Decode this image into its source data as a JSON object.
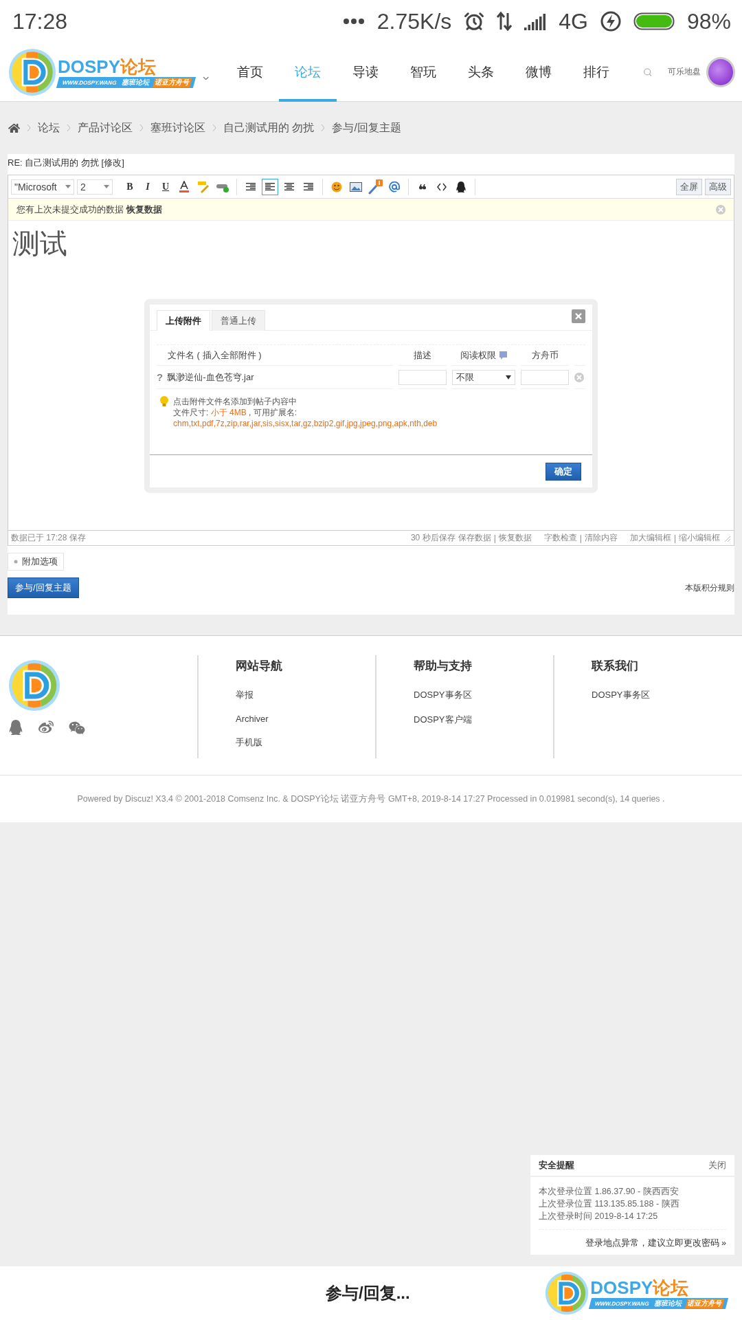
{
  "status_bar": {
    "time": "17:28",
    "speed": "2.75K/s",
    "network": "4G",
    "battery": "98%"
  },
  "header": {
    "logo": {
      "name": "DOSPY",
      "name_cn": "论坛",
      "url": "WWW.DOSPY.WANG",
      "tag_1": "塞班论坛",
      "tag_2": "诺亚方舟号"
    },
    "nav": [
      {
        "label": "首页",
        "selected": false
      },
      {
        "label": "论坛",
        "selected": true
      },
      {
        "label": "导读",
        "selected": false
      },
      {
        "label": "智玩",
        "selected": false
      },
      {
        "label": "头条",
        "selected": false
      },
      {
        "label": "微博",
        "selected": false
      },
      {
        "label": "排行",
        "selected": false
      }
    ],
    "user": "可乐地盘"
  },
  "breadcrumb": [
    "论坛",
    "产品讨论区",
    "塞班讨论区",
    "自己测试用的 勿扰",
    "参与/回复主题"
  ],
  "post": {
    "title": "RE: 自己测试用的 勿扰",
    "edit_link": "[修改]"
  },
  "editor": {
    "font": "\"Microsoft",
    "size": "2",
    "format_buttons": [
      "B",
      "I",
      "U"
    ],
    "align_buttons": [
      {
        "selected": false
      },
      {
        "selected": true
      },
      {
        "selected": false
      },
      {
        "selected": false
      }
    ],
    "right_buttons": [
      "全屏",
      "高级"
    ],
    "notice": {
      "text": "您有上次未提交成功的数据",
      "link": "恢复数据"
    },
    "content": "测试",
    "status": "数据已于 17:28 保存",
    "autosave": "30 秒后保存",
    "separator": "|",
    "action_groups": [
      [
        "保存数据",
        "恢复数据"
      ],
      [
        "字数检查",
        "清除内容"
      ],
      [
        "加大编辑框",
        "缩小编辑框"
      ]
    ]
  },
  "upload_dialog": {
    "tabs": [
      {
        "label": "上传附件",
        "selected": true
      },
      {
        "label": "普通上传",
        "selected": false
      }
    ],
    "columns": [
      "文件名 ( 插入全部附件 )",
      "描述",
      "阅读权限",
      "方舟币"
    ],
    "files": [
      {
        "marker": "?",
        "name": "飘渺逆仙-血色苍穹.jar",
        "permission": "不限"
      }
    ],
    "hint": "点击附件文件名添加到帖子内容中",
    "size_label": "文件尺寸:",
    "size_value": "小于 4MB",
    "ext_label": ", 可用扩展名:",
    "extensions": "chm,txt,pdf,7z,zip,rar,jar,sis,sisx,tar,gz,bzip2,gif,jpg,jpeg,png,apk,nth,deb",
    "confirm": "确定"
  },
  "extra_options": "附加选项",
  "submit": "参与/回复主题",
  "credit_rules": "本版积分规则",
  "footer": {
    "columns": [
      {
        "title": "网站导航",
        "links": [
          "举报",
          "Archiver",
          "手机版"
        ]
      },
      {
        "title": "帮助与支持",
        "links": [
          "DOSPY事务区",
          "DOSPY客户端"
        ]
      },
      {
        "title": "联系我们",
        "links": [
          "DOSPY事务区"
        ]
      }
    ],
    "powered": "Powered by Discuz! X3.4 © 2001-2018 Comsenz Inc. & DOSPY论坛 诺亚方舟号 GMT+8, 2019-8-14 17:27 Processed in 0.019981 second(s), 14 queries ."
  },
  "security_popup": {
    "title": "安全提醒",
    "close": "关闭",
    "lines": [
      "本次登录位置 1.86.37.90 - 陕西西安",
      "上次登录位置 113.135.85.188 - 陕西",
      "上次登录时间 2019-8-14 17:25"
    ],
    "link": "登录地点异常，建议立即更改密码 »"
  },
  "bottom_bar": {
    "title": "参与/回复...",
    "logo": {
      "name": "DOSPY",
      "name_cn": "论坛",
      "url": "WWW.DOSPY.WANG",
      "tag_1": "塞班论坛",
      "tag_2": "诺亚方舟号"
    }
  }
}
